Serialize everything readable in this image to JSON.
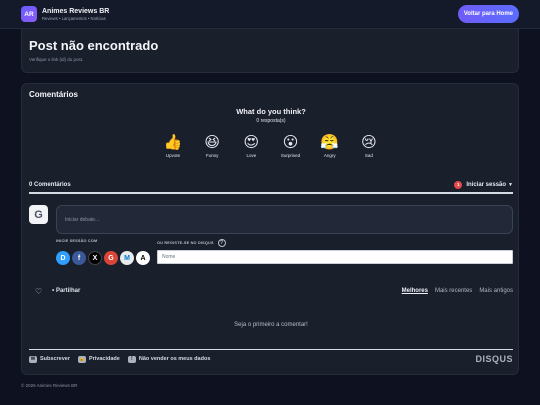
{
  "header": {
    "logo_text": "AR",
    "title": "Animes Reviews BR",
    "subtitle": "Reviews • Lançamentos • Notícias",
    "back_button": "Voltar para Home"
  },
  "post": {
    "title": "Post não encontrado",
    "subtitle": "Verifique o link (id) do post."
  },
  "comments": {
    "section_title": "Comentários",
    "prompt": "What do you think?",
    "responses": "0 resposta(s)",
    "reactions": [
      {
        "emoji": "👍",
        "label": "Upvote"
      },
      {
        "emoji": "😆",
        "label": "Funny"
      },
      {
        "emoji": "😍",
        "label": "Love"
      },
      {
        "emoji": "😮",
        "label": "Surprised"
      },
      {
        "emoji": "😤",
        "label": "Angry"
      },
      {
        "emoji": "😢",
        "label": "Sad"
      }
    ],
    "count_label": "0 Comentários",
    "login_label": "Iniciar sessão",
    "notification_count": "1",
    "avatar_letter": "G",
    "input_placeholder": "Iniciar debate...",
    "login_with": "INICIE SESSÃO COM",
    "register_label": "OU REGISTE-SE NO DISQUS",
    "name_placeholder": "Nome",
    "socials": [
      {
        "icon": "D",
        "color": "#2e9fff"
      },
      {
        "icon": "f",
        "color": "#3b5998"
      },
      {
        "icon": "X",
        "color": "#000000"
      },
      {
        "icon": "G",
        "color": "#db4437"
      },
      {
        "icon": "M",
        "color": "#e9eaee"
      },
      {
        "icon": "A",
        "color": "#ffffff"
      }
    ],
    "share_label": "Partilhar",
    "sort": {
      "best": "Melhores",
      "newest": "Mais recentes",
      "oldest": "Mais antigos"
    },
    "empty": "Seja o primeiro a comentar!",
    "footer": {
      "subscribe": "Subscrever",
      "privacy": "Privacidade",
      "do_not_sell": "Não vender os meus dados",
      "brand": "DISQUS"
    }
  },
  "copyright": "© 2026 Animes Reviews BR"
}
